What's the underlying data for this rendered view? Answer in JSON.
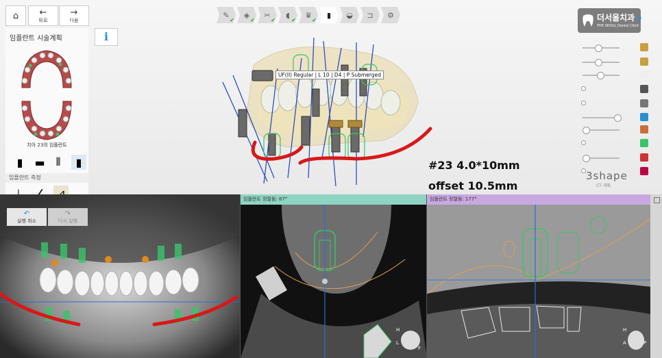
{
  "nav": {
    "home_label": "",
    "back_label": "뒤로",
    "next_label": "다음"
  },
  "left_panel": {
    "title": "임플란트 시술계획",
    "info_glyph": "i",
    "caption": "치아 23의 임플란트",
    "measure_title": "임플란트 측정"
  },
  "undo": {
    "undo_label": "실행 취소",
    "redo_label": "다시 실행"
  },
  "workflow_steps": [
    {
      "icon": "scan-icon",
      "glyph": "✎",
      "done": true
    },
    {
      "icon": "align-icon",
      "glyph": "◈",
      "done": true
    },
    {
      "icon": "segment-icon",
      "glyph": "✂",
      "done": true
    },
    {
      "icon": "tooth-icon",
      "glyph": "◖",
      "done": true
    },
    {
      "icon": "crown-icon",
      "glyph": "♛",
      "done": true
    },
    {
      "icon": "implant-icon",
      "glyph": "▮",
      "done": false
    },
    {
      "icon": "guide-icon",
      "glyph": "◒",
      "done": false
    },
    {
      "icon": "sleeve-icon",
      "glyph": "⊐",
      "done": false
    },
    {
      "icon": "export-icon",
      "glyph": "⚙",
      "done": false
    }
  ],
  "logo": {
    "name": "더서울치과",
    "subtitle": "THE SEOUL Dental Clinic"
  },
  "viewport": {
    "tooltip": "UF(II) Regular | L 10 | D4 | P Submerged",
    "annotation_line1": "#23 4.0*10mm",
    "annotation_line2": "offset 10.5mm",
    "brand": "3shape",
    "brand_sub": "CT 개체"
  },
  "panes": {
    "pano_header": "",
    "cross_header": "임플란트 정렬됨: 87°",
    "tangent_header": "임플란트 정렬됨: 177°"
  },
  "orientation": {
    "cross": [
      "H",
      "L",
      "F"
    ],
    "tangent": [
      "H",
      "A",
      "P"
    ]
  },
  "colors": {
    "accent": "#2a8fd1",
    "cross_header": "#8fd4c2",
    "tangent_header": "#c9a8e0",
    "nerve": "#d81818",
    "implant_green": "#39c46a",
    "tooth_outline": "#e0a050"
  }
}
